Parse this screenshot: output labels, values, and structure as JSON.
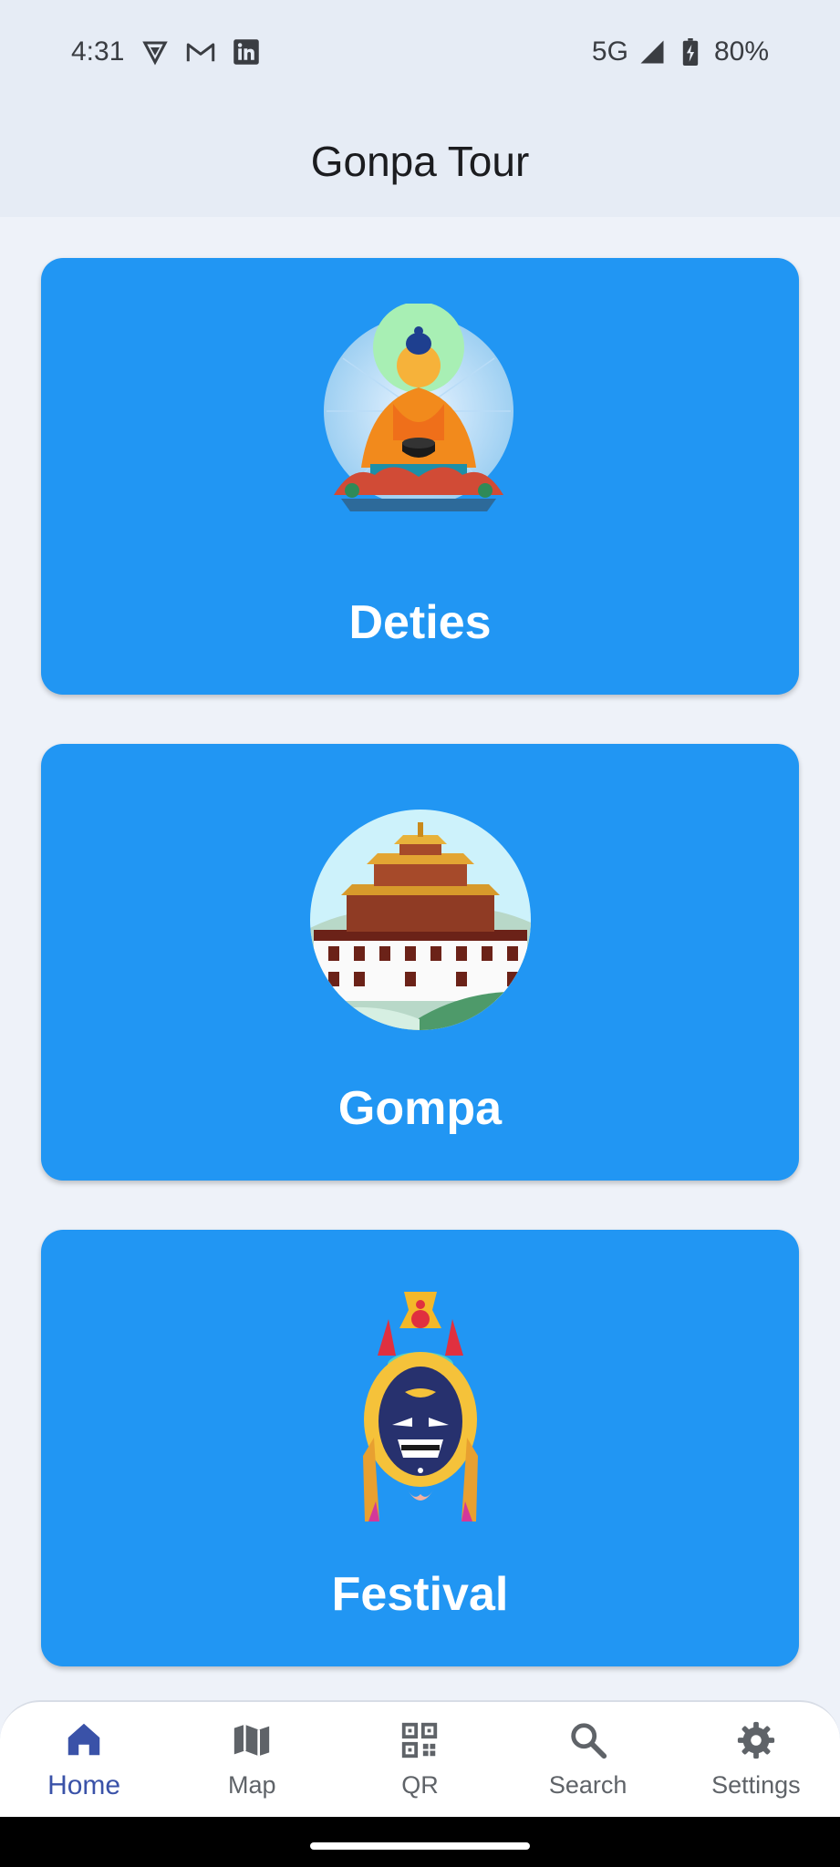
{
  "status_bar": {
    "time": "4:31",
    "network": "5G",
    "battery": "80%",
    "left_icons": [
      "vpn-shield-icon",
      "gmail-icon",
      "linkedin-icon"
    ],
    "right_icons": [
      "signal-icon",
      "battery-icon"
    ]
  },
  "app_bar": {
    "title": "Gonpa Tour"
  },
  "cards": [
    {
      "label": "Deties",
      "image": "buddha-image"
    },
    {
      "label": "Gompa",
      "image": "monastery-image"
    },
    {
      "label": "Festival",
      "image": "mask-image"
    }
  ],
  "bottom_nav": {
    "items": [
      {
        "label": "Home",
        "icon": "home-icon",
        "active": true
      },
      {
        "label": "Map",
        "icon": "map-icon",
        "active": false
      },
      {
        "label": "QR",
        "icon": "qr-code-icon",
        "active": false
      },
      {
        "label": "Search",
        "icon": "search-icon",
        "active": false
      },
      {
        "label": "Settings",
        "icon": "gear-icon",
        "active": false
      }
    ]
  },
  "colors": {
    "card_background": "#2196f3",
    "app_bar_background": "#e6ecf5",
    "page_background": "#eef2f9",
    "active_nav": "#3a52a8",
    "inactive_nav": "#5f6368"
  }
}
